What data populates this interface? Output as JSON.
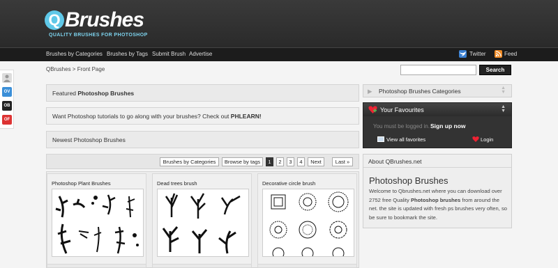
{
  "header": {
    "logo_letter": "Q",
    "logo_text": "Brushes",
    "tagline": "QUALITY BRUSHES FOR PHOTOSHOP"
  },
  "nav": {
    "items": [
      "Brushes by Categories",
      "Brushes by Tags",
      "Submit Brush",
      "Advertise"
    ],
    "twitter": "Twitter",
    "feed": "Feed"
  },
  "breadcrumb": "QBrushes > Front Page",
  "search": {
    "placeholder": "",
    "button": "Search"
  },
  "social": [
    "OV",
    "OB",
    "OF"
  ],
  "main": {
    "featured": {
      "prefix": "Featured ",
      "strong": "Photoshop Brushes"
    },
    "tutorial": {
      "text": "Want Photoshop tutorials to go along with your brushes? Check out ",
      "link": "PHLEARN!"
    },
    "newest": "Newest Photoshop Brushes",
    "pager": {
      "categories_btn": "Brushes by Categories",
      "tags_btn": "Browse by tags",
      "pages": [
        "1",
        "2",
        "3",
        "4"
      ],
      "current": "1",
      "next": "Next",
      "last": "Last »"
    },
    "cards": [
      {
        "title": "Photoshop Plant Brushes"
      },
      {
        "title": "Dead trees brush"
      },
      {
        "title": "Decorative circle brush"
      }
    ]
  },
  "sidebar": {
    "categories_title": "Photoshop Brushes Categories",
    "favourites": {
      "title": "Your Favourites",
      "login_text": "You must be logged in.",
      "signup": "Sign up now",
      "view_all": "View all favorites",
      "login": "Login"
    },
    "about": {
      "head": "About QBrushes.net",
      "title": "Photoshop Brushes",
      "text_before": "Welcome to Qbrushes.net where you can download over 2752 free Quality ",
      "text_strong": "Photoshop brushes",
      "text_after": " from around the net. the site is updated with fresh ps brushes very often, so be sure to bookmark the site."
    }
  },
  "colors": {
    "accent": "#5fc8e8",
    "header_bg": "#333333",
    "nav_bg": "#1c1c1c",
    "fav_bg": "#333333"
  }
}
